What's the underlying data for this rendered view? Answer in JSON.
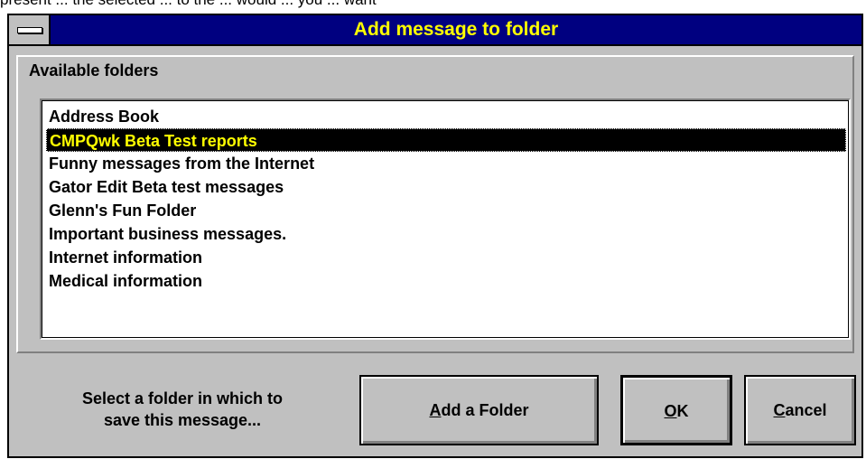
{
  "background_text": "present ... the selected ... to the ... would ... you ... want",
  "dialog": {
    "title": "Add message to folder",
    "group_label": "Available folders",
    "folders": [
      "Address Book",
      "CMPQwk Beta Test reports",
      "Funny messages from the Internet",
      "Gator Edit Beta test messages",
      "Glenn's Fun Folder",
      "Important business messages.",
      "Internet information",
      "Medical information"
    ],
    "selected_index": 1,
    "hint_line1": "Select a folder in which to",
    "hint_line2": "save this message...",
    "add_button": {
      "mnemonic": "A",
      "rest": "dd a Folder"
    },
    "ok_button": {
      "mnemonic": "O",
      "rest": "K"
    },
    "cancel_button": {
      "mnemonic": "C",
      "rest": "ancel"
    }
  },
  "colors": {
    "title_bg": "#000080",
    "title_text": "#ffff00",
    "selection_bg": "#000000",
    "selection_text": "#ffff00",
    "dialog_face": "#c0c0c0"
  }
}
